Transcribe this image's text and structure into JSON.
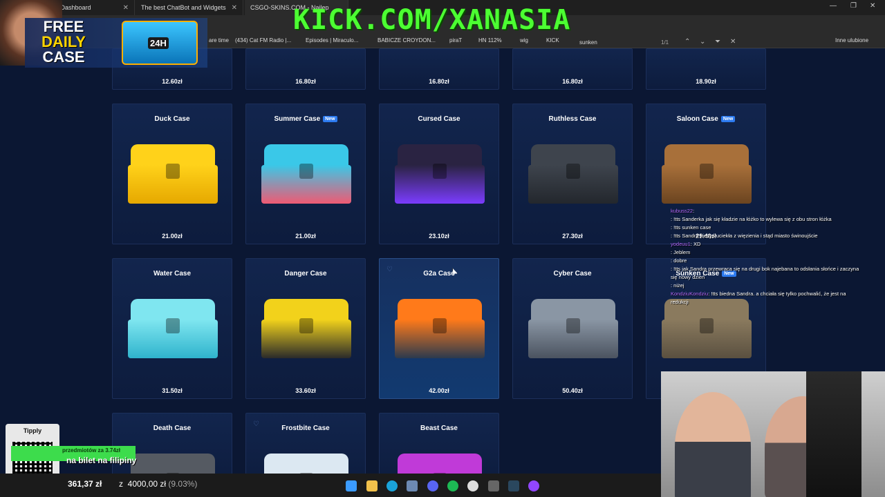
{
  "browser": {
    "tabs": [
      {
        "label": "Kick Dashboard"
      },
      {
        "label": "The best ChatBot and Widgets fo"
      },
      {
        "label": "CSGO-SKINS.COM - Najlep"
      }
    ],
    "bookmarks": [
      "are time",
      "(434) Cat FM Radio |...",
      "Episodes | Miraculo...",
      "BABICZE CROYDON...",
      "piraT",
      "HN 112%",
      "wig",
      "KICK",
      "Inne ulubione"
    ],
    "find": {
      "query": "sunken",
      "count": "1/1"
    }
  },
  "overlay": {
    "kick_banner": "KICK.COM/XANASIA",
    "free_case": {
      "line1": "FREE",
      "line2": "DAILY",
      "line3": "CASE",
      "box_label": "24H"
    }
  },
  "top_row_prices": [
    "12.60zł",
    "16.80zł",
    "16.80zł",
    "16.80zł",
    "18.90zł"
  ],
  "cases": [
    {
      "name": "Duck Case",
      "price": "21.00zł",
      "new": false,
      "colors": [
        "#ffd21a",
        "#e6a800"
      ]
    },
    {
      "name": "Summer Case",
      "price": "21.00zł",
      "new": true,
      "new_label": "New",
      "colors": [
        "#3ac8e8",
        "#ef5a73"
      ]
    },
    {
      "name": "Cursed Case",
      "price": "23.10zł",
      "new": false,
      "colors": [
        "#2a2342",
        "#7b3cff"
      ]
    },
    {
      "name": "Ruthless Case",
      "price": "27.30zł",
      "new": false,
      "colors": [
        "#3e444d",
        "#23272d"
      ]
    },
    {
      "name": "Saloon Case",
      "price": "29.40zł",
      "new": true,
      "new_label": "New",
      "colors": [
        "#a8703a",
        "#6b4420"
      ]
    },
    {
      "name": "Water Case",
      "price": "31.50zł",
      "new": false,
      "colors": [
        "#7fe6f0",
        "#2fb3cc"
      ]
    },
    {
      "name": "Danger Case",
      "price": "33.60zł",
      "new": false,
      "colors": [
        "#f2d21b",
        "#2a2a2a"
      ]
    },
    {
      "name": "G2a Case",
      "price": "42.00zł",
      "new": false,
      "colors": [
        "#ff7a1a",
        "#2c3a4d"
      ]
    },
    {
      "name": "Cyber Case",
      "price": "50.40zł",
      "new": false,
      "colors": [
        "#8a96a4",
        "#4b5360"
      ]
    },
    {
      "name": "Sunken Case",
      "price": "",
      "new": true,
      "new_label": "New",
      "colors": [
        "#8a7a5e",
        "#5a5040"
      ]
    },
    {
      "name": "Death Case",
      "price": "",
      "new": false,
      "colors": [
        "#555a62",
        "#2c2f34"
      ]
    },
    {
      "name": "Frostbite Case",
      "price": "",
      "new": false,
      "colors": [
        "#dce8f2",
        "#8fa6bd"
      ]
    },
    {
      "name": "Beast Case",
      "price": "",
      "new": false,
      "colors": [
        "#c03ad8",
        "#3a8fff"
      ]
    }
  ],
  "chat": [
    {
      "user": "kubuss22",
      "msg": ":"
    },
    {
      "user": "",
      "msg": ": !tts Sanderka jak się kładzie na łóżko to wylewa się z obu stron łóżka"
    },
    {
      "user": "",
      "msg": ": !tts sunken case"
    },
    {
      "user": "",
      "msg": ": !tts Sandra kiedyś uciekła z więzienia i stąd miasto świnoujście"
    },
    {
      "user": "yodeuu1",
      "msg": ": XD"
    },
    {
      "user": "",
      "msg": ": Jeblem"
    },
    {
      "user": "",
      "msg": ": dobre"
    },
    {
      "user": "",
      "msg": ": !tts jak Sandra przewraca się na drugi bok najebana to odsłania słońce i zaczyna się nowy dzień"
    },
    {
      "user": "",
      "msg": ": niżej"
    },
    {
      "user": "KondziuKondziu",
      "msg": ": !tts biedna Sandra. a chciała się tylko pochwalić, że jest na redukcji"
    }
  ],
  "tipply": {
    "title": "Tipply",
    "alert": "przedmiotów za 3.74zł",
    "alert_big": "na bilet na filipiny"
  },
  "taskbar": {
    "amount": "361,37 zł",
    "goal_prefix": "z",
    "goal": "4000,00 zł",
    "percent": "(9.03%)"
  },
  "colors": {
    "page_bg": "#0b1733",
    "card_bg": "#12254d",
    "new_badge": "#2d7bf0",
    "kick_green": "#4cff32"
  }
}
